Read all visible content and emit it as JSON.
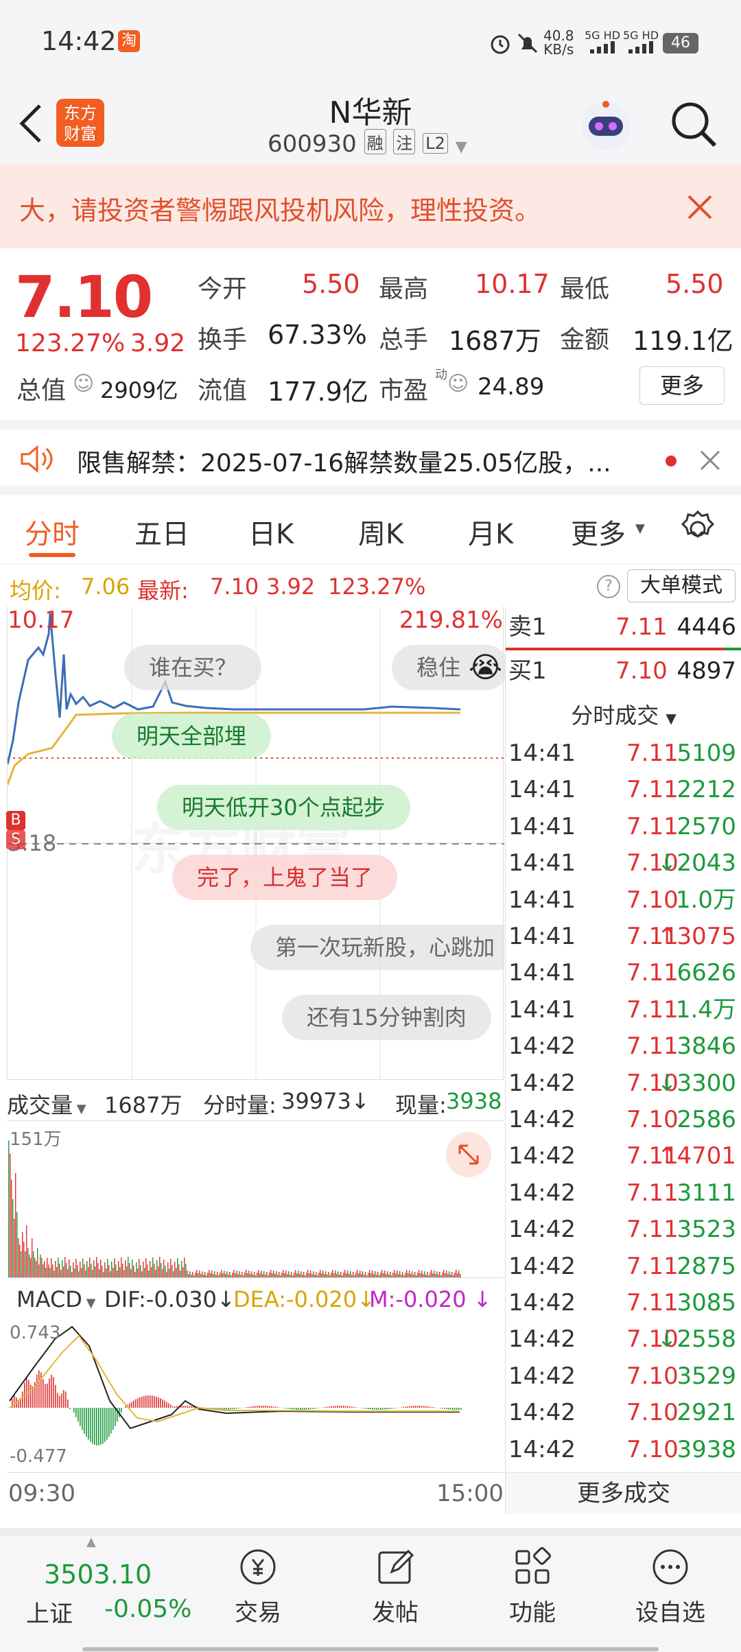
{
  "status": {
    "time": "14:42",
    "app_badge": "淘",
    "speed_num": "40.8",
    "speed_unit": "KB/s",
    "net1": "5G HD",
    "net2": "5G HD",
    "battery": "46"
  },
  "header": {
    "title": "N华新",
    "code": "600930",
    "tag_rong": "融",
    "tag_zhu": "注",
    "tag_l2": "L2",
    "logo_line1": "东方",
    "logo_line2": "财富"
  },
  "warning": {
    "text": "大，请投资者警惕跟风投机风险，理性投资。"
  },
  "quote": {
    "price": "7.10",
    "change_pct": "123.27%",
    "change": "3.92",
    "open_label": "今开",
    "open": "5.50",
    "high_label": "最高",
    "high": "10.17",
    "low_label": "最低",
    "low": "5.50",
    "turnover_label": "换手",
    "turnover": "67.33%",
    "volume_label": "总手",
    "volume": "1687万",
    "amount_label": "金额",
    "amount": "119.1亿",
    "mktcap_label": "总值",
    "mktcap": "2909亿",
    "float_label": "流值",
    "float_cap": "177.9亿",
    "pe_label": "市盈",
    "pe_sup": "动",
    "pe": "24.89",
    "more": "更多"
  },
  "notice": {
    "text": "限售解禁：2025-07-16解禁数量25.05亿股，..."
  },
  "tabs": [
    "分时",
    "五日",
    "日K",
    "周K",
    "月K",
    "更多"
  ],
  "avgline": {
    "avg_label": "均价:",
    "avg": "7.06",
    "latest_label": "最新:",
    "latest": "7.10",
    "change": "3.92",
    "pct": "123.27%",
    "help": "?",
    "big_mode": "大单模式"
  },
  "chart": {
    "top_price": "10.17",
    "top_pct": "219.81%",
    "ref_price": "3.18",
    "start_time": "09:30",
    "end_time": "15:00",
    "b_marker": "B",
    "s_marker": "S",
    "watermark": "东方财富"
  },
  "bubbles": [
    "谁在买？",
    "稳住",
    "明天全部埋",
    "明天低开30个点起步",
    "完了，上鬼了当了",
    "第一次玩新股，心跳加",
    "还有15分钟割肉"
  ],
  "volume": {
    "label": "成交量",
    "total": "1687万",
    "tick_label": "分时量:",
    "tick": "39973",
    "now_label": "现量:",
    "now": "3938",
    "max": "151万"
  },
  "macd": {
    "label": "MACD",
    "dif": "DIF:-0.030",
    "dea": "DEA:-0.020",
    "m": "M:-0.020",
    "max": "0.743",
    "min": "-0.477"
  },
  "orderbook": {
    "sell_label": "卖1",
    "sell_price": "7.11",
    "sell_vol": "4446",
    "buy_label": "买1",
    "buy_price": "7.10",
    "buy_vol": "4897",
    "ticks_title": "分时成交",
    "more_ticks": "更多成交"
  },
  "ticks": [
    {
      "t": "14:41",
      "p": "7.11",
      "v": "5109",
      "d": ""
    },
    {
      "t": "14:41",
      "p": "7.11",
      "v": "2212",
      "d": ""
    },
    {
      "t": "14:41",
      "p": "7.11",
      "v": "2570",
      "d": ""
    },
    {
      "t": "14:41",
      "p": "7.10",
      "v": "2043",
      "d": "down"
    },
    {
      "t": "14:41",
      "p": "7.10",
      "v": "1.0万",
      "d": ""
    },
    {
      "t": "14:41",
      "p": "7.11",
      "v": "3075",
      "d": "up"
    },
    {
      "t": "14:41",
      "p": "7.11",
      "v": "6626",
      "d": ""
    },
    {
      "t": "14:41",
      "p": "7.11",
      "v": "1.4万",
      "d": ""
    },
    {
      "t": "14:42",
      "p": "7.11",
      "v": "3846",
      "d": ""
    },
    {
      "t": "14:42",
      "p": "7.10",
      "v": "3300",
      "d": "down"
    },
    {
      "t": "14:42",
      "p": "7.10",
      "v": "2586",
      "d": ""
    },
    {
      "t": "14:42",
      "p": "7.11",
      "v": "4701",
      "d": "up"
    },
    {
      "t": "14:42",
      "p": "7.11",
      "v": "3111",
      "d": ""
    },
    {
      "t": "14:42",
      "p": "7.11",
      "v": "3523",
      "d": ""
    },
    {
      "t": "14:42",
      "p": "7.11",
      "v": "2875",
      "d": ""
    },
    {
      "t": "14:42",
      "p": "7.11",
      "v": "3085",
      "d": ""
    },
    {
      "t": "14:42",
      "p": "7.10",
      "v": "2558",
      "d": "down"
    },
    {
      "t": "14:42",
      "p": "7.10",
      "v": "3529",
      "d": ""
    },
    {
      "t": "14:42",
      "p": "7.10",
      "v": "2921",
      "d": ""
    },
    {
      "t": "14:42",
      "p": "7.10",
      "v": "3938",
      "d": ""
    }
  ],
  "index": {
    "value": "3503.10",
    "name": "上证",
    "change": "-0.05%"
  },
  "bottom_nav": [
    "交易",
    "发帖",
    "功能",
    "设自选"
  ],
  "colors": {
    "up": "#e0302f",
    "down": "#1a9a3a",
    "accent": "#f25d22",
    "price_line": "#3a6fb5",
    "avg_line": "#e3b53a"
  }
}
